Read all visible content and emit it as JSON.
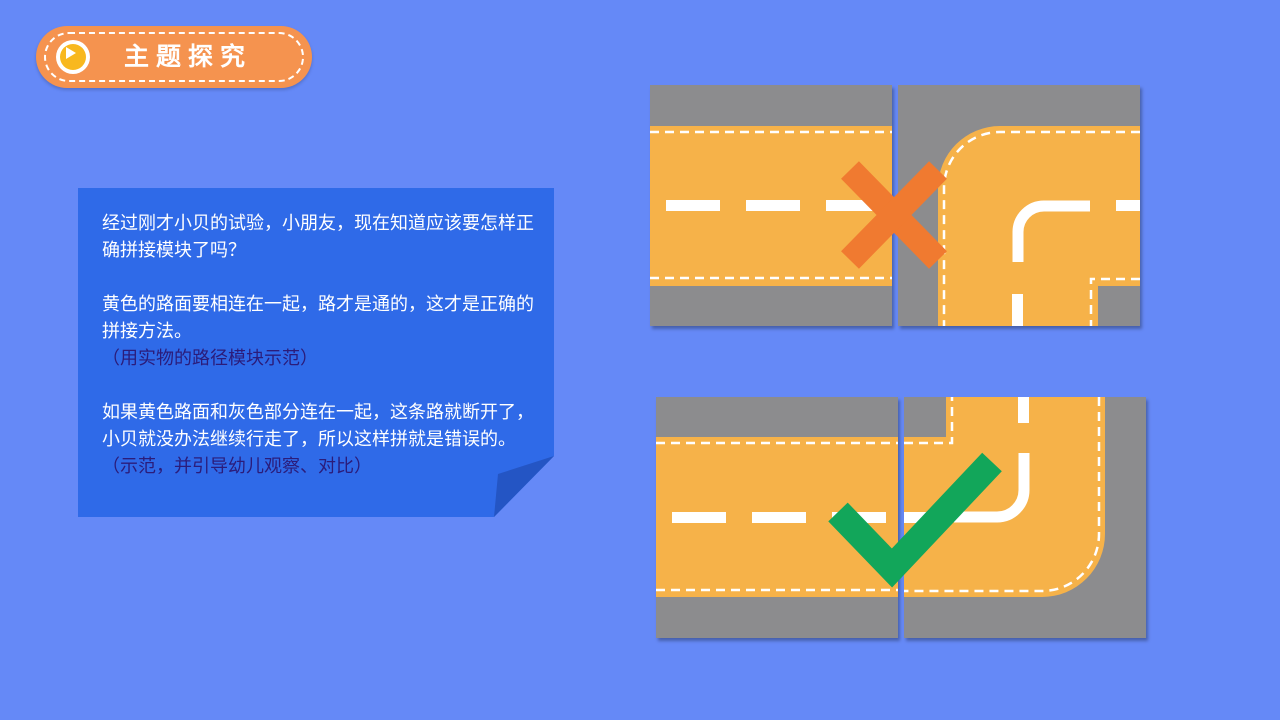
{
  "header": {
    "title": "主题探究",
    "icon": "play-icon"
  },
  "note": {
    "para1": "经过刚才小贝的试验，小朋友，现在知道应该要怎样正确拼接模块了吗？",
    "para2": "黄色的路面要相连在一起，路才是通的，这才是正确的拼接方法。",
    "hint2": "（用实物的路径模块示范）",
    "para3": "如果黄色路面和灰色部分连在一起，这条路就断开了，小贝就没办法继续行走了，所以这样拼就是错误的。",
    "hint3": "（示范，并引导幼儿观察、对比）"
  },
  "puzzles": {
    "wrong": {
      "result": "wrong",
      "icon": "cross-icon",
      "mark_color": "#f07a30"
    },
    "right": {
      "result": "correct",
      "icon": "check-icon",
      "mark_color": "#12a65a"
    }
  },
  "colors": {
    "background": "#6589f7",
    "road": "#f6b24a",
    "asphalt": "#8c8c8e",
    "note": "#2f6ae8",
    "title_pill": "#f5934f"
  }
}
